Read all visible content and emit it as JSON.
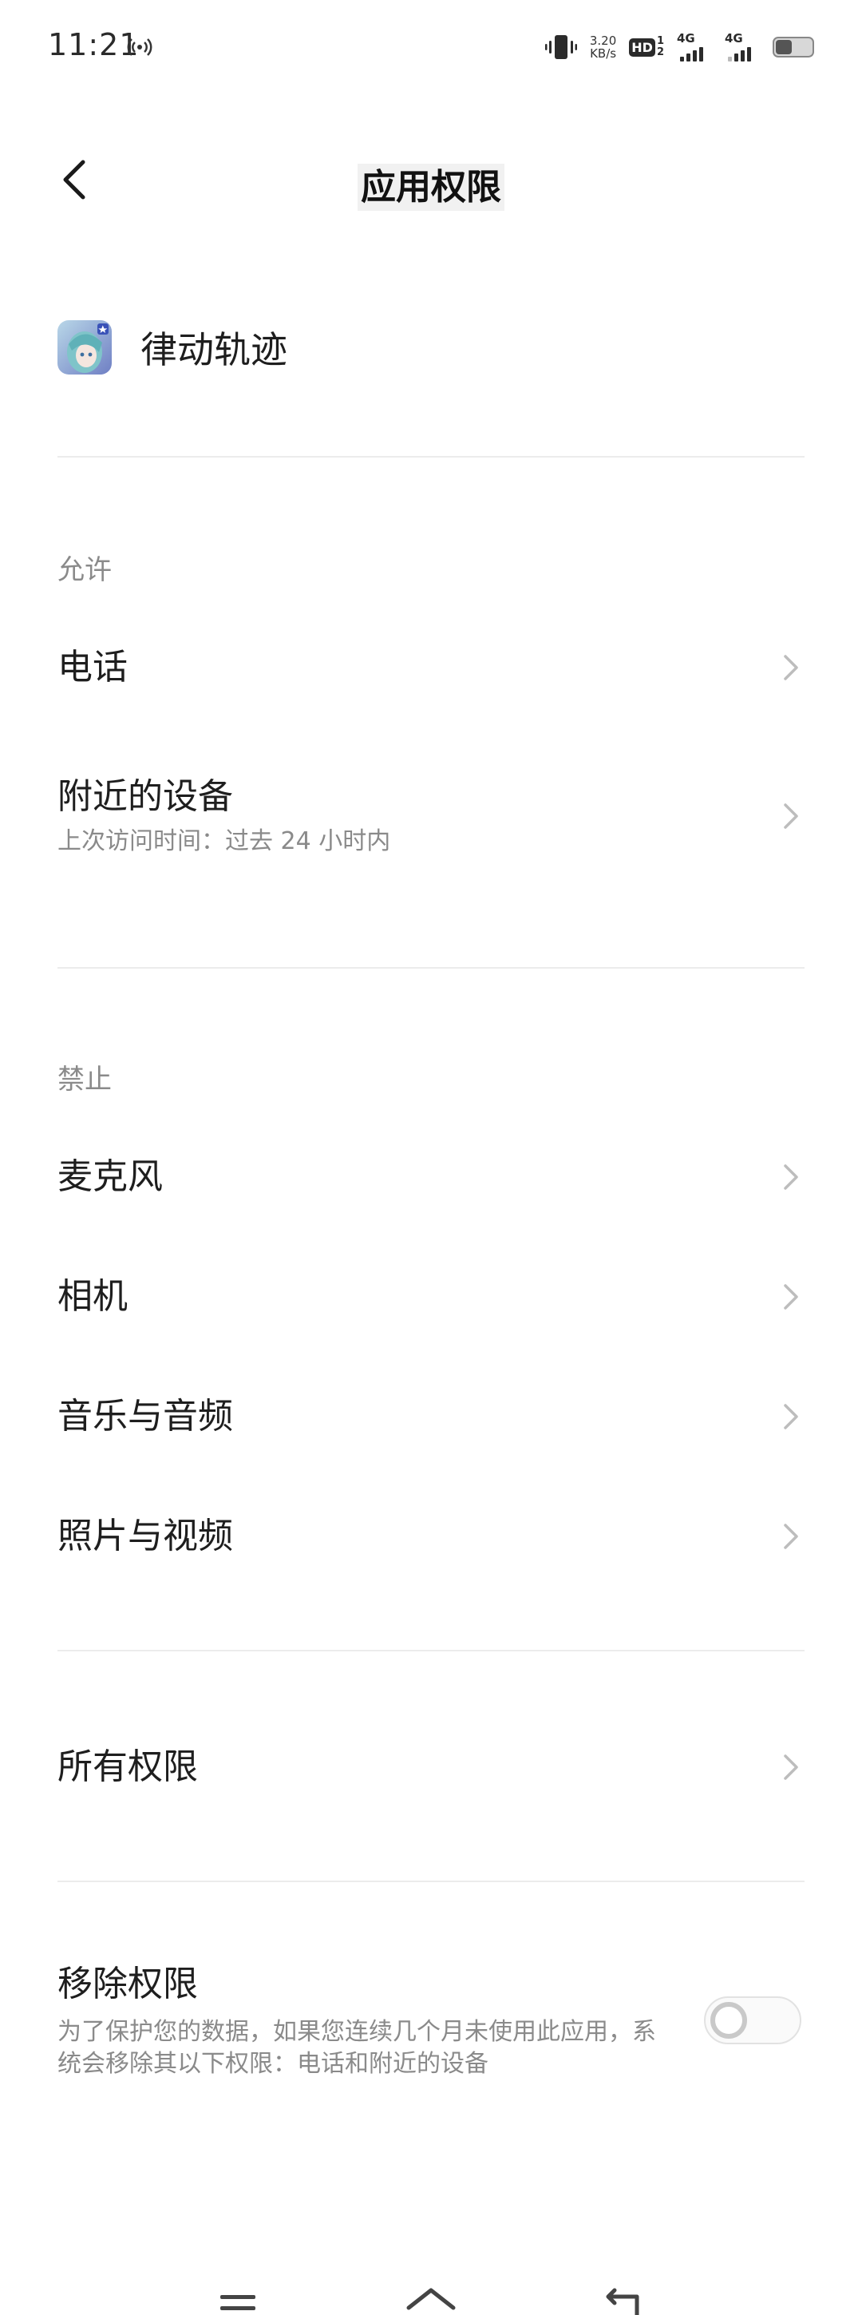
{
  "status_bar": {
    "time": "11:21",
    "net_speed_value": "3.20",
    "net_speed_unit": "KB/s",
    "hd_label": "HD",
    "hd_sim_top": "1",
    "hd_sim_bottom": "2",
    "net1_label": "4G",
    "net2_label": "4G",
    "battery_level": 0.45,
    "icons": [
      "hotspot-icon",
      "vibrate-icon",
      "hd-icon",
      "signal-icon",
      "signal-icon",
      "battery-icon"
    ]
  },
  "header": {
    "title": "应用权限",
    "back_icon": "chevron-left-icon"
  },
  "app": {
    "name": "律动轨迹",
    "icon": "app-avatar-icon"
  },
  "allowed": {
    "title": "允许",
    "items": [
      {
        "label": "电话",
        "subtitle": ""
      },
      {
        "label": "附近的设备",
        "subtitle": "上次访问时间：过去 24 小时内"
      }
    ]
  },
  "denied": {
    "title": "禁止",
    "items": [
      {
        "label": "麦克风"
      },
      {
        "label": "相机"
      },
      {
        "label": "音乐与音频"
      },
      {
        "label": "照片与视频"
      }
    ]
  },
  "all_permissions": {
    "label": "所有权限"
  },
  "remove_permissions": {
    "title": "移除权限",
    "description": "为了保护您的数据，如果您连续几个月未使用此应用，系统会移除其以下权限：电话和附近的设备",
    "enabled": false
  },
  "nav_bar": {
    "icons": [
      "menu-icon",
      "home-icon",
      "back-icon"
    ]
  },
  "colors": {
    "text_primary": "#1e1e1e",
    "text_secondary": "#8a8a8a",
    "divider": "#ececec",
    "background": "#ffffff"
  }
}
